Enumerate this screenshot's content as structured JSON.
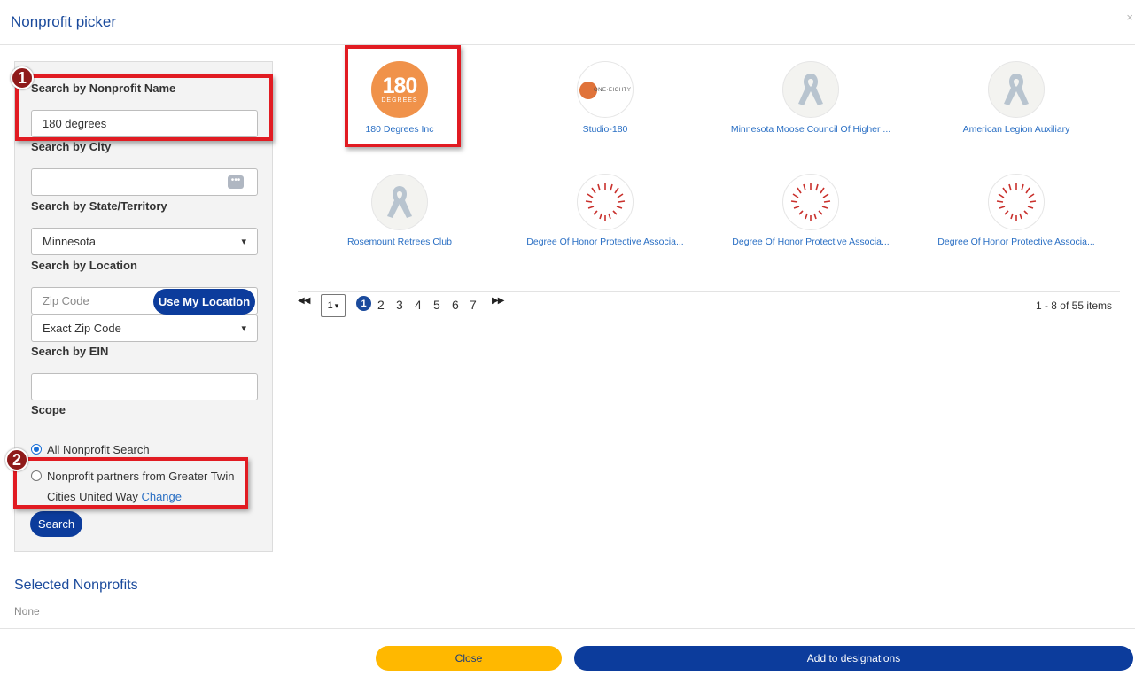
{
  "header": {
    "title": "Nonprofit picker",
    "close_glyph": "×"
  },
  "sidebar": {
    "name_label": "Search by Nonprofit Name",
    "name_value": "180 degrees",
    "city_label": "Search by City",
    "city_value": "",
    "state_label": "Search by State/Territory",
    "state_selected": "Minnesota",
    "location_label": "Search by Location",
    "zip_placeholder": "Zip Code",
    "use_location_label": "Use My Location",
    "zip_mode_selected": "Exact Zip Code",
    "ein_label": "Search by EIN",
    "ein_value": "",
    "scope_label": "Scope",
    "scope_options": [
      {
        "label": "All Nonprofit Search",
        "selected": true
      },
      {
        "label": "Nonprofit partners from Greater Twin Cities United Way",
        "selected": false
      }
    ],
    "change_link": "Change",
    "search_button": "Search"
  },
  "callouts": [
    {
      "number": "1",
      "color": "#e11b22"
    },
    {
      "number": "2",
      "color": "#e11b22"
    }
  ],
  "results": [
    {
      "name": "180 Degrees Inc",
      "logo_text": "180",
      "logo_subtext": "DEGREES",
      "logo": "orange-circle-logo"
    },
    {
      "name": "Studio-180",
      "logo_text": "ONE·EIGHTY",
      "logo": "basketball-logo"
    },
    {
      "name": "Minnesota Moose Council Of Higher ...",
      "logo": "ribbon-icon"
    },
    {
      "name": "American Legion Auxiliary",
      "logo": "ribbon-icon"
    },
    {
      "name": "Rosemount Retrees Club",
      "logo": "ribbon-icon"
    },
    {
      "name": "Degree Of Honor Protective Associa...",
      "logo": "red-heart-burst-logo"
    },
    {
      "name": "Degree Of Honor Protective Associa...",
      "logo": "red-heart-burst-logo"
    },
    {
      "name": "Degree Of Honor Protective Associa...",
      "logo": "red-heart-burst-logo"
    }
  ],
  "pagination": {
    "first_glyph": "◀◀",
    "last_glyph": "▶▶",
    "page_select": "1",
    "current": "1",
    "pages": [
      "2",
      "3",
      "4",
      "5",
      "6",
      "7"
    ],
    "info": "1 - 8 of 55 items"
  },
  "selected": {
    "title": "Selected Nonprofits",
    "empty_text": "None"
  },
  "footer": {
    "close_label": "Close",
    "add_label": "Add to designations"
  },
  "colors": {
    "brand_blue": "#0c3c9c",
    "accent_yellow": "#ffb800",
    "callout_red": "#e11b22"
  }
}
